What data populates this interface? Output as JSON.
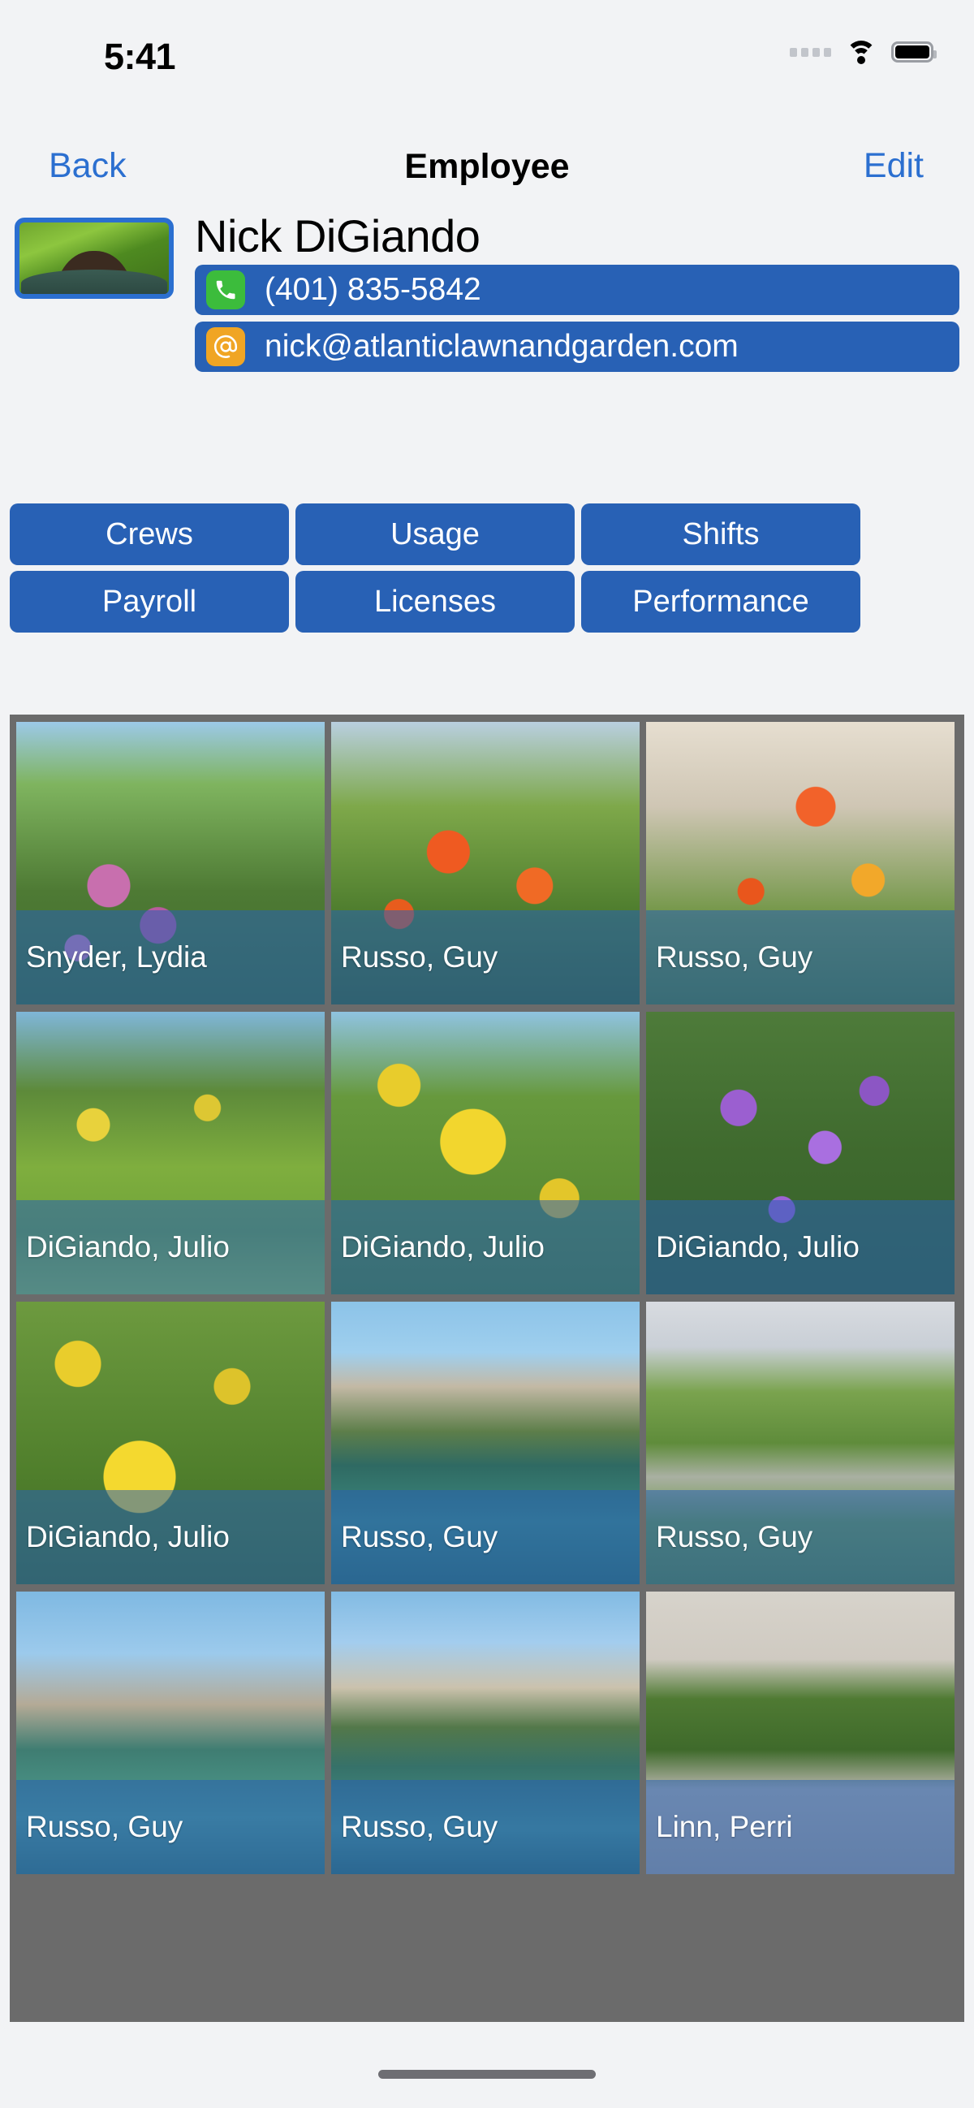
{
  "status_bar": {
    "time": "5:41",
    "icons": [
      "cellular-dots-icon",
      "wifi-icon",
      "battery-icon"
    ]
  },
  "nav_bar": {
    "back_label": "Back",
    "title": "Employee",
    "edit_label": "Edit"
  },
  "profile": {
    "name": "Nick DiGiando",
    "avatar_alt": "employee-photo",
    "phone": {
      "value": "(401) 835-5842",
      "icon": "phone-icon",
      "icon_color": "#3cbc3c"
    },
    "email": {
      "value": "nick@atlanticlawnandgarden.com",
      "icon": "at-sign-icon",
      "icon_color": "#f0a524"
    }
  },
  "action_buttons": [
    {
      "label": "Crews"
    },
    {
      "label": "Usage"
    },
    {
      "label": "Shifts"
    },
    {
      "label": "Payroll"
    },
    {
      "label": "Licenses"
    },
    {
      "label": "Performance"
    }
  ],
  "photo_grid": {
    "items": [
      {
        "caption": "Snyder, Lydia",
        "style": "p-cone"
      },
      {
        "caption": "Russo, Guy",
        "style": "p-rose"
      },
      {
        "caption": "Russo, Guy",
        "style": "p-rose2"
      },
      {
        "caption": "DiGiando, Julio",
        "style": "p-yellowfield"
      },
      {
        "caption": "DiGiando, Julio",
        "style": "p-yellowfl"
      },
      {
        "caption": "DiGiando, Julio",
        "style": "p-purple"
      },
      {
        "caption": "DiGiando, Julio",
        "style": "p-yellowfl2"
      },
      {
        "caption": "Russo, Guy",
        "style": "p-pool"
      },
      {
        "caption": "Russo, Guy",
        "style": "p-hedge"
      },
      {
        "caption": "Russo, Guy",
        "style": "p-pool3"
      },
      {
        "caption": "Russo, Guy",
        "style": "p-pool4"
      },
      {
        "caption": "Linn, Perri",
        "style": "p-drive"
      }
    ]
  },
  "colors": {
    "accent_blue": "#2861b5",
    "link_blue": "#2b6fd0",
    "page_bg": "#f2f3f5",
    "grid_bg": "#6b6b6b"
  }
}
